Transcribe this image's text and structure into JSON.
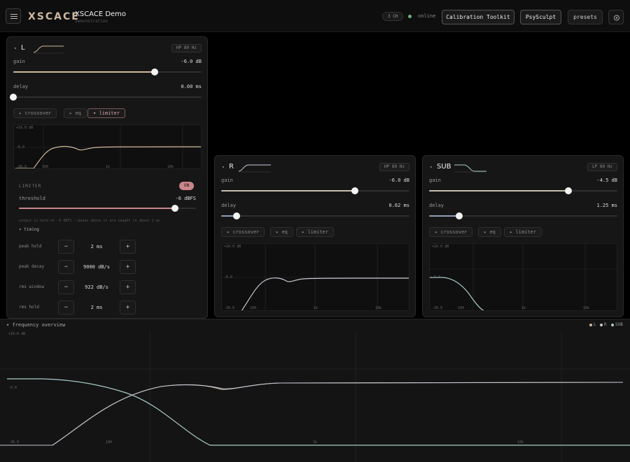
{
  "header": {
    "logo": "XSCACE",
    "title": "XSCACE Demo",
    "subtitle": "demonstration",
    "channels_badge": "3 CH",
    "status": "online",
    "btn_calibration": "Calibration Toolkit",
    "btn_psysculpt": "PsySculpt",
    "btn_presets": "presets"
  },
  "colors": {
    "accent_L": "#cdb89a",
    "accent_R": "#c6c9d6",
    "accent_SUB": "#a9cac8",
    "limiter_on": "#c9868b",
    "online": "#6fb178"
  },
  "graph_labels": {
    "top": "+10.0 dB",
    "mid": "-6.0",
    "bottom": "-30.0",
    "f100": "100",
    "f1k": "1k",
    "f10k": "10k"
  },
  "channels": {
    "L": {
      "name": "L",
      "filter": "HP 80 Hz",
      "gain_label": "gain",
      "gain_value": "-6.0 dB",
      "gain_pos": 0.75,
      "delay_label": "delay",
      "delay_value": "0.00 ms",
      "delay_pos": 0.0,
      "tabs": [
        "crossover",
        "eq",
        "limiter"
      ]
    },
    "R": {
      "name": "R",
      "filter": "HP 80 Hz",
      "gain_label": "gain",
      "gain_value": "-6.0 dB",
      "gain_pos": 0.71,
      "delay_label": "delay",
      "delay_value": "0.62 ms",
      "delay_pos": 0.08,
      "tabs": [
        "crossover",
        "eq",
        "limiter"
      ]
    },
    "SUB": {
      "name": "SUB",
      "filter": "LP 80 Hz",
      "gain_label": "gain",
      "gain_value": "-4.5 dB",
      "gain_pos": 0.74,
      "delay_label": "delay",
      "delay_value": "1.25 ms",
      "delay_pos": 0.16,
      "tabs": [
        "crossover",
        "eq",
        "limiter"
      ]
    }
  },
  "limiter": {
    "title": "LIMITER",
    "state": "ON",
    "threshold_label": "threshold",
    "threshold_value": "-6 dBFS",
    "threshold_pos": 0.88,
    "note": "output is held at -6 dBFS — peaks above it are caught in about 2 ms",
    "timing_label": "timing",
    "rows": [
      {
        "label": "peak hold",
        "value": "2 ms"
      },
      {
        "label": "peak decay",
        "value": "9000 dB/s"
      },
      {
        "label": "rms window",
        "value": "922 dB/s"
      },
      {
        "label": "rms hold",
        "value": "2 ms"
      }
    ]
  },
  "overview": {
    "title": "frequency overview",
    "legend": [
      "L",
      "R",
      "SUB"
    ]
  }
}
